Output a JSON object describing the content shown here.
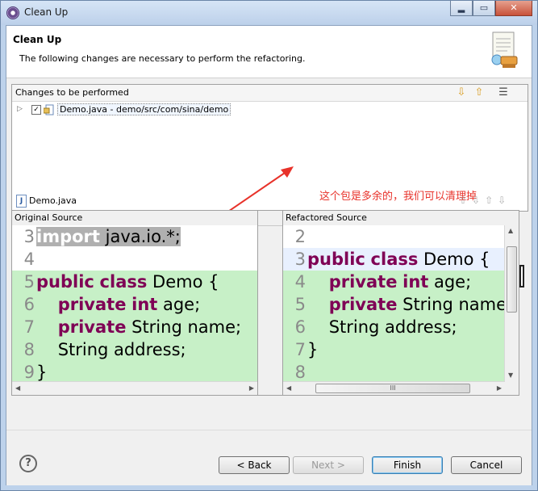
{
  "window": {
    "title": "Clean Up",
    "min_glyph": "▂",
    "max_glyph": "▭",
    "close_glyph": "✕"
  },
  "banner": {
    "title": "Clean Up",
    "description": "The following changes are necessary to perform the refactoring."
  },
  "changes": {
    "header": "Changes to be performed",
    "tree": [
      {
        "label": "Demo.java - demo/src/com/sina/demo",
        "checked": true
      }
    ]
  },
  "annotation": {
    "text": "这个包是多余的，我们可以清理掉",
    "color": "#e8322a"
  },
  "compare": {
    "file": "Demo.java",
    "original_header": "Original Source",
    "refactored_header": "Refactored Source",
    "original_lines": [
      {
        "n": "3",
        "parts": [
          [
            "kw",
            "import"
          ],
          [
            "",
            " java.io.*;"
          ]
        ]
      },
      {
        "n": "4",
        "parts": []
      },
      {
        "n": "5",
        "parts": [
          [
            "kw",
            "public"
          ],
          [
            "",
            " "
          ],
          [
            "kw",
            "class"
          ],
          [
            "",
            " Demo {"
          ]
        ]
      },
      {
        "n": "6",
        "parts": [
          [
            "",
            "    "
          ],
          [
            "kw",
            "private"
          ],
          [
            "",
            " "
          ],
          [
            "kw",
            "int"
          ],
          [
            "",
            " age;"
          ]
        ]
      },
      {
        "n": "7",
        "parts": [
          [
            "",
            "    "
          ],
          [
            "kw",
            "private"
          ],
          [
            "",
            " String name;"
          ]
        ]
      },
      {
        "n": "8",
        "parts": [
          [
            "",
            "    String address;"
          ]
        ]
      },
      {
        "n": "9",
        "parts": [
          [
            "",
            "}"
          ]
        ]
      }
    ],
    "refactored_lines": [
      {
        "n": "2",
        "parts": []
      },
      {
        "n": "3",
        "parts": [
          [
            "kw",
            "public"
          ],
          [
            "",
            " "
          ],
          [
            "kw",
            "class"
          ],
          [
            "",
            " Demo {"
          ]
        ]
      },
      {
        "n": "4",
        "parts": [
          [
            "",
            "    "
          ],
          [
            "kw",
            "private"
          ],
          [
            "",
            " "
          ],
          [
            "kw",
            "int"
          ],
          [
            "",
            " age;"
          ]
        ]
      },
      {
        "n": "5",
        "parts": [
          [
            "",
            "    "
          ],
          [
            "kw",
            "private"
          ],
          [
            "",
            " String name;"
          ]
        ]
      },
      {
        "n": "6",
        "parts": [
          [
            "",
            "    String address;"
          ]
        ]
      },
      {
        "n": "7",
        "parts": [
          [
            "",
            "}"
          ]
        ]
      },
      {
        "n": "8",
        "parts": []
      }
    ],
    "scroll_grip": "III"
  },
  "buttons": {
    "help": "?",
    "back": "< Back",
    "next": "Next >",
    "finish": "Finish",
    "cancel": "Cancel"
  },
  "icons": {
    "move-down": "⇩",
    "move-up": "⇧",
    "filter": "☰"
  }
}
